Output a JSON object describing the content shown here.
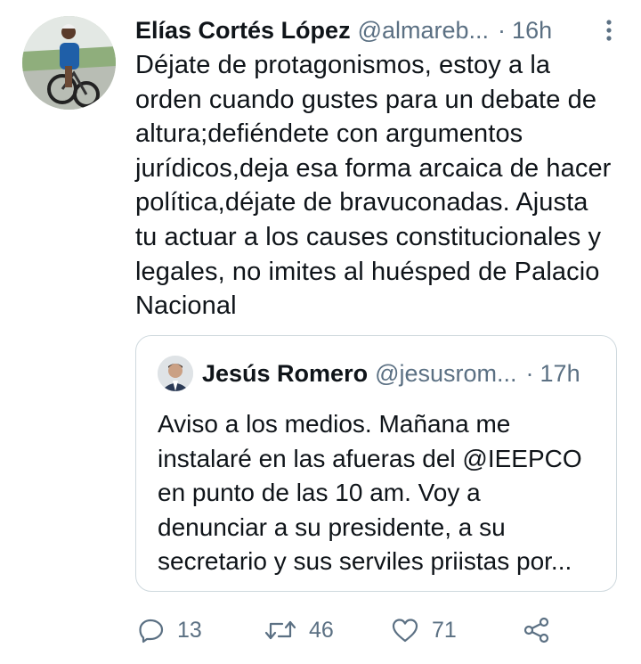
{
  "tweet": {
    "author_name": "Elías Cortés López",
    "handle": "@almareb...",
    "separator": "·",
    "time": "16h",
    "text": "Déjate de protagonismos, estoy a la\norden cuando gustes para un debate de\naltura;defiéndete con argumentos\njurídicos,deja esa forma arcaica de hacer\npolítica,déjate de bravuconadas. Ajusta\ntu actuar a los causes constitucionales y\nlegales, no imites al huésped de Palacio\nNacional"
  },
  "quoted_tweet": {
    "author_name": "Jesús Romero",
    "handle": "@jesusrom...",
    "separator": "·",
    "time": "17h",
    "text": "Aviso a los medios. Mañana me\ninstalaré en las afueras del @IEEPCO\nen punto de las 10 am. Voy a\ndenunciar a su presidente,  a su\nsecretario y sus serviles priistas por..."
  },
  "actions": {
    "reply_count": "13",
    "retweet_count": "46",
    "like_count": "71"
  },
  "colors": {
    "text": "#0f1419",
    "muted": "#5b7083",
    "border": "#cfd9de"
  },
  "icons": [
    "more-vertical-icon",
    "reply-icon",
    "retweet-icon",
    "like-icon",
    "share-icon"
  ]
}
